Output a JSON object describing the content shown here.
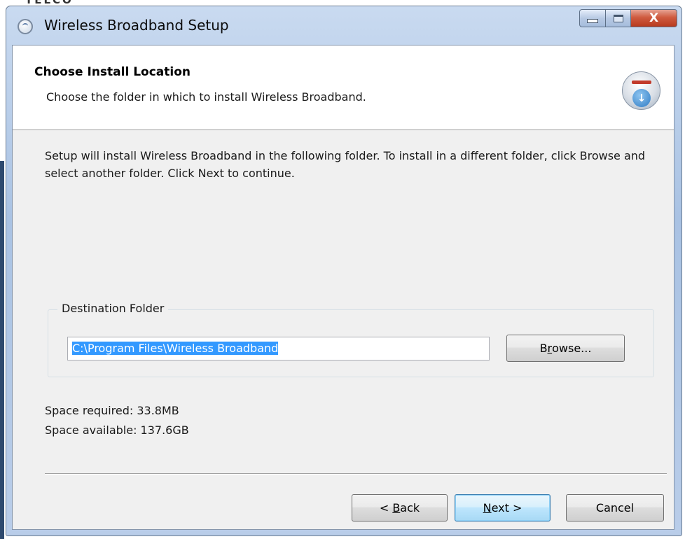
{
  "background": {
    "fragment_text": "TELCO"
  },
  "window": {
    "title": "Wireless Broadband Setup",
    "caption_buttons": {
      "close_glyph": "X"
    }
  },
  "header": {
    "title": "Choose Install Location",
    "subtitle": "Choose the folder in which to install Wireless Broadband."
  },
  "body": {
    "instructions": "Setup will install Wireless Broadband in the following folder. To install in a different folder, click Browse and select another folder. Click Next to continue."
  },
  "destination": {
    "group_label": "Destination Folder",
    "path_value": "C:\\Program Files\\Wireless Broadband",
    "browse_label_pre": "B",
    "browse_label_accel": "r",
    "browse_label_post": "owse..."
  },
  "space": {
    "required": "Space required: 33.8MB",
    "available": "Space available: 137.6GB"
  },
  "buttons": {
    "back_pre": "< ",
    "back_accel": "B",
    "back_post": "ack",
    "next_accel": "N",
    "next_post": "ext >",
    "cancel": "Cancel"
  },
  "colors": {
    "selection": "#3399ff",
    "close_button": "#c7472a",
    "default_button_border": "#3c7fb1"
  },
  "icons": [
    "setup-app-icon",
    "installer-download-icon",
    "minimize-icon",
    "maximize-icon",
    "close-icon"
  ]
}
